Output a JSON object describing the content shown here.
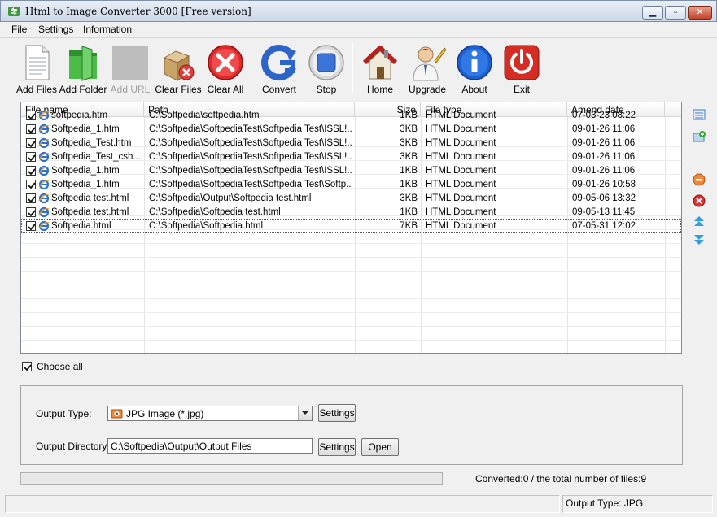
{
  "window": {
    "title": "Html to Image Converter 3000 [Free version]"
  },
  "menu": {
    "items": [
      "File",
      "Settings",
      "Information"
    ]
  },
  "toolbar": {
    "add_files": "Add Files",
    "add_folder": "Add Folder",
    "add_url": "Add URL",
    "clear_files": "Clear Files",
    "clear_all": "Clear All",
    "convert": "Convert",
    "stop": "Stop",
    "home": "Home",
    "upgrade": "Upgrade",
    "about": "About",
    "exit": "Exit"
  },
  "table": {
    "columns": [
      "File name",
      "Path",
      "Size",
      "File type",
      "Amend date"
    ],
    "rows": [
      {
        "name": "softpedia.htm",
        "path": "C:\\Softpedia\\softpedia.htm",
        "size": "1KB",
        "type": "HTML Document",
        "date": "07-03-23 08:22",
        "checked": true
      },
      {
        "name": "Softpedia_1.htm",
        "path": "C:\\Softpedia\\SoftpediaTest\\Softpedia Test\\ISSL!...",
        "size": "3KB",
        "type": "HTML Document",
        "date": "09-01-26 11:06",
        "checked": true
      },
      {
        "name": "Softpedia_Test.htm",
        "path": "C:\\Softpedia\\SoftpediaTest\\Softpedia Test\\ISSL!...",
        "size": "3KB",
        "type": "HTML Document",
        "date": "09-01-26 11:06",
        "checked": true
      },
      {
        "name": "Softpedia_Test_csh....",
        "path": "C:\\Softpedia\\SoftpediaTest\\Softpedia Test\\ISSL!...",
        "size": "3KB",
        "type": "HTML Document",
        "date": "09-01-26 11:06",
        "checked": true
      },
      {
        "name": "Softpedia_1.htm",
        "path": "C:\\Softpedia\\SoftpediaTest\\Softpedia Test\\ISSL!...",
        "size": "1KB",
        "type": "HTML Document",
        "date": "09-01-26 11:06",
        "checked": true
      },
      {
        "name": "Softpedia_1.htm",
        "path": "C:\\Softpedia\\SoftpediaTest\\Softpedia Test\\Softp...",
        "size": "1KB",
        "type": "HTML Document",
        "date": "09-01-26 10:58",
        "checked": true
      },
      {
        "name": "Softpedia test.html",
        "path": "C:\\Softpedia\\Output\\Softpedia test.html",
        "size": "3KB",
        "type": "HTML Document",
        "date": "09-05-06 13:32",
        "checked": true
      },
      {
        "name": "Softpedia test.html",
        "path": "C:\\Softpedia\\Softpedia test.html",
        "size": "1KB",
        "type": "HTML Document",
        "date": "09-05-13 11:45",
        "checked": true
      },
      {
        "name": "Softpedia.html",
        "path": "C:\\Softpedia\\Softpedia.html",
        "size": "7KB",
        "type": "HTML Document",
        "date": "07-05-31 12:02",
        "checked": true
      }
    ]
  },
  "choose_all": {
    "label": "Choose all",
    "checked": true
  },
  "options": {
    "output_type_label": "Output Type:",
    "output_type_value": "JPG Image (*.jpg)",
    "output_dir_label": "Output Directory:",
    "output_dir_value": "C:\\Softpedia\\Output\\Output Files",
    "settings_label": "Settings",
    "open_label": "Open"
  },
  "progress": {
    "value": 0
  },
  "status": {
    "converted": "Converted:0  /  the total number of files:9",
    "output_type": "Output Type: JPG"
  },
  "colors": {
    "accent": "#3a78c9",
    "exit_red": "#d32d24",
    "stop_blue": "#3b73d6"
  }
}
